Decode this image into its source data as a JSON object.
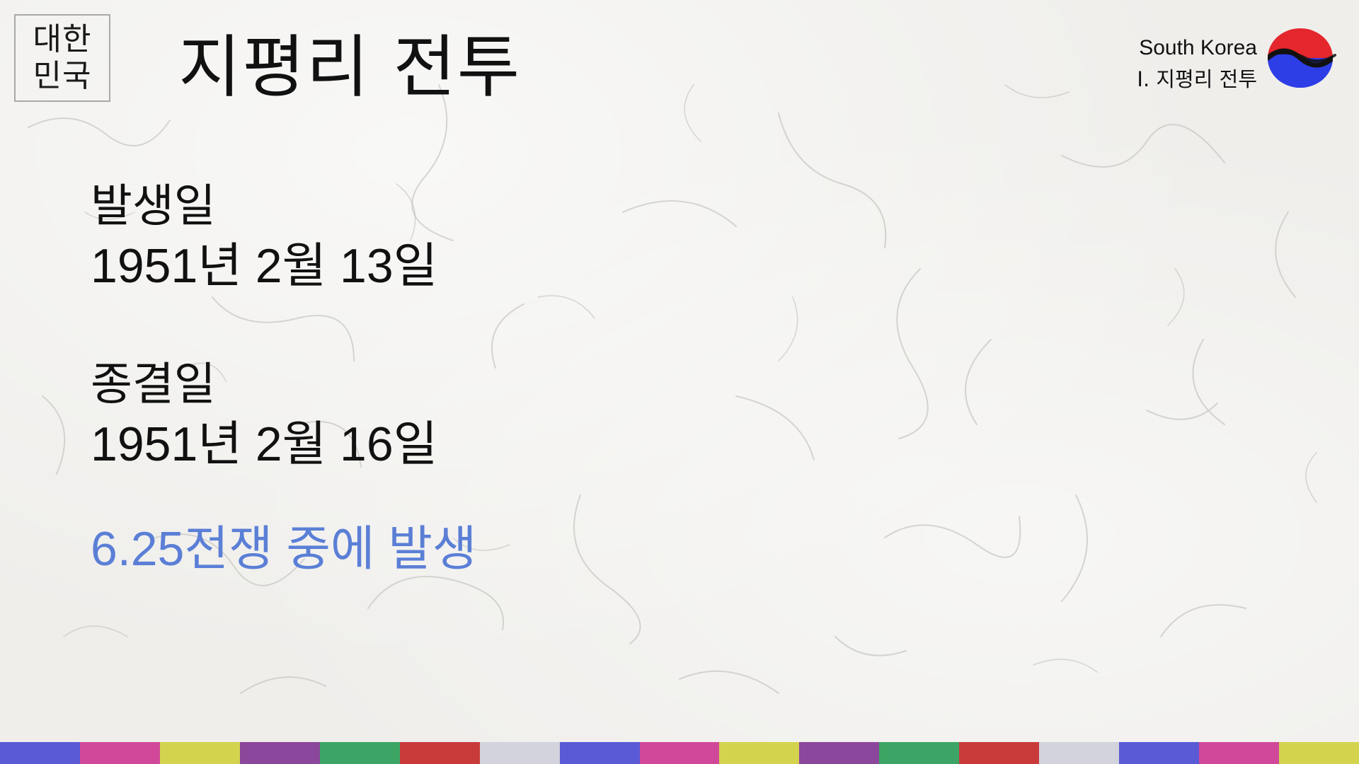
{
  "stamp": {
    "line1": "대한",
    "line2": "민국"
  },
  "title": "지평리 전투",
  "corner": {
    "country": "South Korea",
    "section": "Ⅰ. 지평리 전투"
  },
  "content": {
    "start_label": "발생일",
    "start_date": "1951년 2월 13일",
    "end_label": "종결일",
    "end_date": "1951년 2월 16일",
    "note": "6.25전쟁 중에 발생"
  },
  "colors": {
    "note_text": "#5b7fd6",
    "taegeuk_red": "#e4262d",
    "taegeuk_blue": "#2d3ee6",
    "stripe": [
      "#5a5ad6",
      "#d1489a",
      "#d3d34e",
      "#8b479b",
      "#3ca566",
      "#c93b3b",
      "#d2d3dc",
      "#5a5ad6",
      "#d1489a",
      "#d3d34e",
      "#8b479b",
      "#3ca566",
      "#c93b3b",
      "#d2d3dc",
      "#5a5ad6",
      "#d1489a",
      "#d3d34e"
    ]
  },
  "icons": {
    "logo": "taegeuk-icon"
  }
}
